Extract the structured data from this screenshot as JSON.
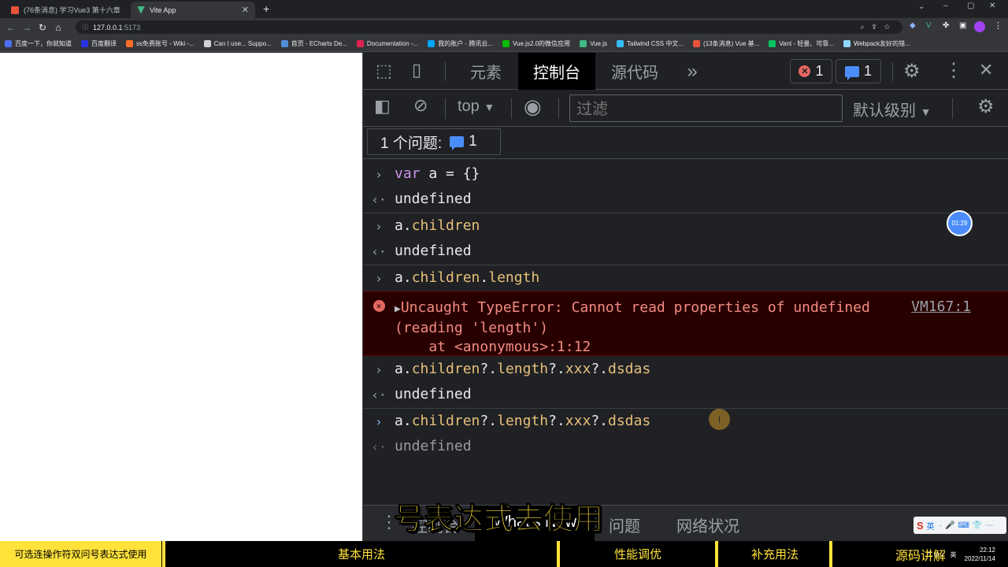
{
  "browser": {
    "tabs": [
      {
        "title": "(76条消息) 学习Vue3 第十六章",
        "favicon_color": "#e8533c",
        "active": false
      },
      {
        "title": "Vite App",
        "favicon_color": "#41b883",
        "active": true
      }
    ],
    "new_tab": "+",
    "url_host": "127.0.0.1",
    "url_port": ":5173",
    "bookmarks": [
      {
        "label": "百度一下，你就知道",
        "color": "#4e6ef2"
      },
      {
        "label": "百度翻译",
        "color": "#2932e1"
      },
      {
        "label": "ss免费账号 - Wiki -...",
        "color": "#fc6d26"
      },
      {
        "label": "Can I use... Suppo...",
        "color": "#d0d0d0"
      },
      {
        "label": "首页 - ECharts De...",
        "color": "#4e8ed7"
      },
      {
        "label": "Documentation -...",
        "color": "#e0234e"
      },
      {
        "label": "我的账户 - 腾讯云...",
        "color": "#00a4ff"
      },
      {
        "label": "Vue.js2.0的微信应用",
        "color": "#09bb07"
      },
      {
        "label": "Vue.js",
        "color": "#41b883"
      },
      {
        "label": "Tailwind CSS 中文...",
        "color": "#38bdf8"
      },
      {
        "label": "(13条消息) Vue 基...",
        "color": "#e8533c"
      },
      {
        "label": "Vant - 轻量、可靠...",
        "color": "#07c160"
      },
      {
        "label": "Webpack友好的错...",
        "color": "#8ed6fb"
      }
    ]
  },
  "devtools": {
    "tabs": [
      "元素",
      "控制台",
      "源代码"
    ],
    "more": "»",
    "error_count": "1",
    "message_count": "1",
    "context": "top",
    "filter_placeholder": "过滤",
    "level": "默认级别",
    "issues_label": "1 个问题:",
    "issues_count": "1",
    "console": {
      "l1_kw": "var",
      "l1_rest": " a = {}",
      "l2": "undefined",
      "l3_a": "a.",
      "l3_b": "children",
      "l4": "undefined",
      "l5_a": "a.",
      "l5_b": "children",
      "l5_c": ".",
      "l5_d": "length",
      "err_line1": "Uncaught TypeError: Cannot read properties of undefined",
      "err_line2": "(reading 'length')",
      "err_line3": "    at <anonymous>:1:12",
      "err_source": "VM167:1",
      "l7_a": "a.",
      "l7_b": "children",
      "l7_c": "?.",
      "l7_d": "length",
      "l7_e": "?.",
      "l7_f": "xxx",
      "l7_g": "?.",
      "l7_h": "dsdas",
      "l8": "undefined",
      "l9_a": "a.",
      "l9_b": "children",
      "l9_c": "?.",
      "l9_d": "length",
      "l9_e": "?.",
      "l9_f": "xxx",
      "l9_g": "?.",
      "l9_h": "dsdas",
      "l10": "undefined"
    },
    "drawer_tabs": [
      "控制台",
      "What's New",
      "问题",
      "网络状况"
    ]
  },
  "video_overlay": {
    "subtitle": "号表达式去使用",
    "timer": "01:29",
    "chapters": {
      "current": "可选连操作符双问号表达式使用",
      "c1": "基本用法",
      "c2": "性能调优",
      "c3": "补充用法",
      "c4": "源码讲解"
    }
  },
  "taskbar": {
    "ime_label": "英",
    "tray_lang": "英",
    "time": "22:12",
    "date": "2022/11/14"
  }
}
